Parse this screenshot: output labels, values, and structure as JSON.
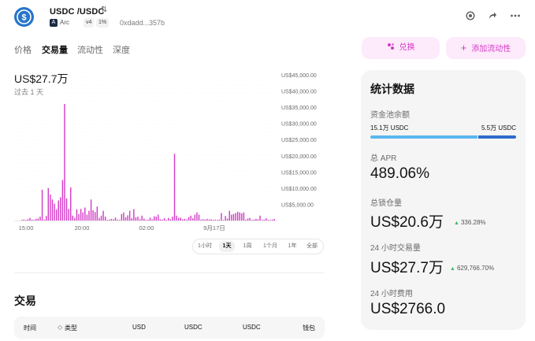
{
  "header": {
    "pair": "USDC /USDC",
    "chain": "Arc",
    "chain_icon": "A",
    "version": "v4",
    "fee_tier": "1%",
    "address": "0xdadd...357b",
    "logo_icon": "usdc-logo",
    "brand_color": "#2775ca"
  },
  "tabs": [
    "价格",
    "交易量",
    "流动性",
    "深度"
  ],
  "active_tab": "交易量",
  "actions": {
    "swap": "兑换",
    "add_liquidity": "添加流动性",
    "accent": "#d43bc7"
  },
  "volume": {
    "value": "US$27.7万",
    "period": "过去 1 天"
  },
  "chart_data": {
    "type": "bar",
    "ylim": [
      0,
      45000
    ],
    "yticks": [
      "US$45,000.00",
      "US$40,000.00",
      "US$35,000.00",
      "US$30,000.00",
      "US$25,000.00",
      "US$20,000.00",
      "US$15,000.00",
      "US$10,000.00",
      "US$5,000.00"
    ],
    "xticks": [
      "15:00",
      "20:00",
      "02:00",
      "9月17日"
    ],
    "bar_color": "#d43bc7",
    "values": [
      200,
      300,
      200,
      400,
      800,
      300,
      200,
      500,
      600,
      1200,
      9500,
      300,
      1400,
      10000,
      8000,
      6500,
      5200,
      3400,
      6200,
      7200,
      12500,
      36000,
      6800,
      3600,
      10200,
      1500,
      800,
      3500,
      2000,
      3600,
      2500,
      4000,
      1800,
      3000,
      6500,
      3200,
      2600,
      4300,
      800,
      1500,
      3000,
      1200,
      200,
      300,
      500,
      400,
      900,
      300,
      200,
      2000,
      2500,
      1000,
      1600,
      3000,
      700,
      3500,
      1000,
      1200,
      400,
      1500,
      600,
      200,
      300,
      900,
      400,
      1300,
      1200,
      1800,
      400,
      300,
      700,
      200,
      800,
      400,
      1200,
      20600,
      1500,
      800,
      900,
      400,
      500,
      300,
      1000,
      1500,
      700,
      1800,
      2500,
      1800,
      300,
      400,
      300,
      500,
      300,
      400,
      200,
      300,
      200,
      300,
      2300,
      200,
      1400,
      600,
      3000,
      1800,
      2000,
      2300,
      2700,
      2500,
      2200,
      2500,
      300,
      600,
      800,
      200,
      300,
      500,
      400,
      1500,
      200,
      300,
      700,
      200,
      200,
      300,
      500
    ]
  },
  "range_buttons": [
    "1小时",
    "1天",
    "1周",
    "1个月",
    "1年",
    "全部"
  ],
  "active_range": "1天",
  "transactions": {
    "title": "交易",
    "columns": [
      "时间",
      "类型",
      "USD",
      "USDC",
      "USDC",
      "钱包"
    ]
  },
  "stats": {
    "title": "统计数据",
    "tvl_label": "资金池余额",
    "tvl_left": "15.1万 USDC",
    "tvl_right": "5.5万 USDC",
    "tvl_left_fraction": 0.733,
    "apr_label": "总 APR",
    "apr_value": "489.06%",
    "tvl_total_label": "总锁仓量",
    "tvl_total_value": "US$20.6万",
    "tvl_change": "336.28%",
    "volume_label": "24 小时交易量",
    "volume_value": "US$27.7万",
    "volume_change": "629,766.70%",
    "fees_label": "24 小时费用",
    "fees_value": "US$2766.0",
    "up_color": "#40b66b"
  }
}
